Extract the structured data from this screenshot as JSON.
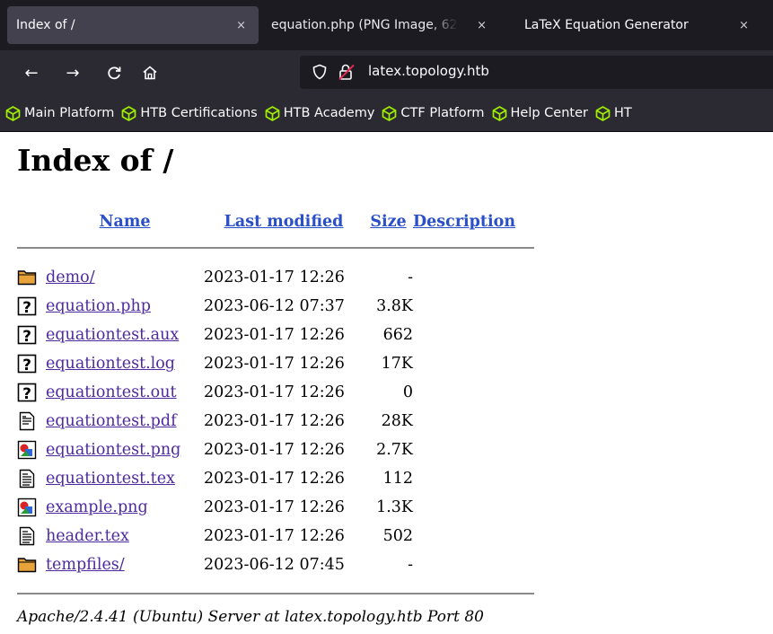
{
  "tabs": [
    {
      "title": "Index of /",
      "close": "×"
    },
    {
      "title": "equation.php (PNG Image, 62",
      "close": "×"
    },
    {
      "title": "LaTeX Equation Generator",
      "close": "×"
    }
  ],
  "nav": {
    "back": "←",
    "forward": "→",
    "reload": "C",
    "home": "⌂"
  },
  "urlbar": {
    "url": "latex.topology.htb"
  },
  "bookmarks": [
    {
      "label": "Main Platform",
      "icon": "htb-cube-icon"
    },
    {
      "label": "HTB Certifications",
      "icon": "htb-cube-icon"
    },
    {
      "label": "HTB Academy",
      "icon": "htb-cube-icon"
    },
    {
      "label": "CTF Platform",
      "icon": "htb-cube-icon"
    },
    {
      "label": "Help Center",
      "icon": "htb-cube-icon"
    },
    {
      "label": "HT",
      "icon": "htb-cube-icon"
    }
  ],
  "page": {
    "heading": "Index of /",
    "columns": {
      "name": "Name",
      "modified": "Last modified",
      "size": "Size",
      "description": "Description"
    },
    "rows": [
      {
        "icon": "folder-icon",
        "name": "demo/",
        "modified": "2023-01-17 12:26",
        "size": "-",
        "description": ""
      },
      {
        "icon": "unknown-file-icon",
        "name": "equation.php",
        "modified": "2023-06-12 07:37",
        "size": "3.8K",
        "description": ""
      },
      {
        "icon": "unknown-file-icon",
        "name": "equationtest.aux",
        "modified": "2023-01-17 12:26",
        "size": "662",
        "description": ""
      },
      {
        "icon": "unknown-file-icon",
        "name": "equationtest.log",
        "modified": "2023-01-17 12:26",
        "size": "17K",
        "description": ""
      },
      {
        "icon": "unknown-file-icon",
        "name": "equationtest.out",
        "modified": "2023-01-17 12:26",
        "size": "0",
        "description": ""
      },
      {
        "icon": "document-file-icon",
        "name": "equationtest.pdf",
        "modified": "2023-01-17 12:26",
        "size": "28K",
        "description": ""
      },
      {
        "icon": "image-file-icon",
        "name": "equationtest.png",
        "modified": "2023-01-17 12:26",
        "size": "2.7K",
        "description": ""
      },
      {
        "icon": "text-file-icon",
        "name": "equationtest.tex",
        "modified": "2023-01-17 12:26",
        "size": "112",
        "description": ""
      },
      {
        "icon": "image-file-icon",
        "name": "example.png",
        "modified": "2023-01-17 12:26",
        "size": "1.3K",
        "description": ""
      },
      {
        "icon": "text-file-icon",
        "name": "header.tex",
        "modified": "2023-01-17 12:26",
        "size": "502",
        "description": ""
      },
      {
        "icon": "folder-icon",
        "name": "tempfiles/",
        "modified": "2023-06-12 07:45",
        "size": "-",
        "description": ""
      }
    ],
    "footer": "Apache/2.4.41 (Ubuntu) Server at latex.topology.htb Port 80"
  },
  "colors": {
    "chrome_dark": "#1c1b22",
    "chrome_mid": "#2b2a33",
    "active_tab": "#42414d",
    "htb_green": "#9fef00",
    "link": "#2a4fc6",
    "visited_link": "#4e2a9e"
  }
}
